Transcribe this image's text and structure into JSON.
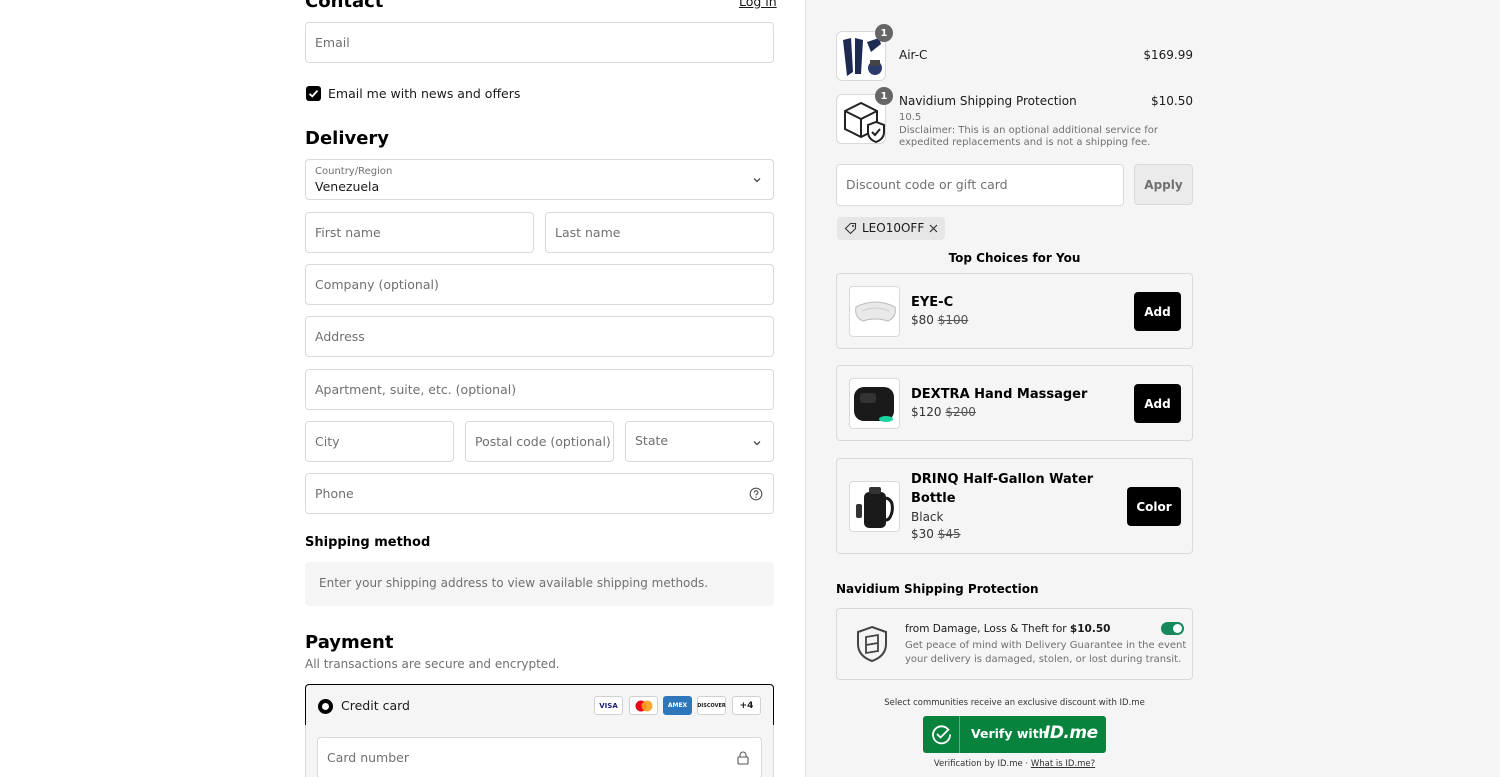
{
  "contact": {
    "heading": "Contact",
    "login_link": "Log in",
    "email_placeholder": "Email",
    "newsletter_label": "Email me with news and offers"
  },
  "delivery": {
    "heading": "Delivery",
    "country_label": "Country/Region",
    "country_value": "Venezuela",
    "first_name": "First name",
    "last_name": "Last name",
    "company": "Company (optional)",
    "address": "Address",
    "apartment": "Apartment, suite, etc. (optional)",
    "city": "City",
    "postal": "Postal code (optional)",
    "state": "State",
    "phone": "Phone"
  },
  "shipping": {
    "heading": "Shipping method",
    "note": "Enter your shipping address to view available shipping methods."
  },
  "payment": {
    "heading": "Payment",
    "subtitle": "All transactions are secure and encrypted.",
    "method_label": "Credit card",
    "cards": [
      "VISA",
      "",
      "AMEX",
      "DISCOVER"
    ],
    "more_cards": "+4",
    "card_number": "Card number"
  },
  "cart": {
    "items": [
      {
        "qty": "1",
        "name": "Air-C",
        "price": "$169.99"
      },
      {
        "qty": "1",
        "name": "Navidium Shipping Protection",
        "price": "$10.50",
        "variant": "10.5",
        "disclaimer_1": "Disclaimer: This is an optional additional service for",
        "disclaimer_2": "expedited replacements and is not a shipping fee."
      }
    ],
    "discount_placeholder": "Discount code or gift card",
    "apply_label": "Apply",
    "applied_code": "LEO10OFF"
  },
  "upsells": {
    "heading": "Top Choices for You",
    "items": [
      {
        "name": "EYE-C",
        "price": "$80",
        "compare": "$100",
        "button": "Add"
      },
      {
        "name": "DEXTRA Hand Massager",
        "price": "$120",
        "compare": "$200",
        "button": "Add"
      },
      {
        "name_1": "DRINQ Half-Gallon Water",
        "name_2": "Bottle",
        "variant": "Black",
        "price": "$30",
        "compare": "$45",
        "button": "Color"
      }
    ]
  },
  "protection": {
    "heading": "Navidium Shipping Protection",
    "line_prefix": "from Damage, Loss & Theft for ",
    "line_price": "$10.50",
    "desc_1": "Get peace of mind with Delivery Guarantee in the event",
    "desc_2": "your delivery is damaged, stolen, or lost during transit."
  },
  "idme": {
    "note": "Select communities receive an exclusive discount with ID.me",
    "button_label": "Verify with",
    "brand": "ID.me",
    "footer_prefix": "Verification by ID.me · ",
    "footer_link": "What is ID.me?"
  },
  "colors": {
    "accent_green": "#08833d",
    "toggle_green": "#168a5c",
    "button_black": "#000000"
  }
}
